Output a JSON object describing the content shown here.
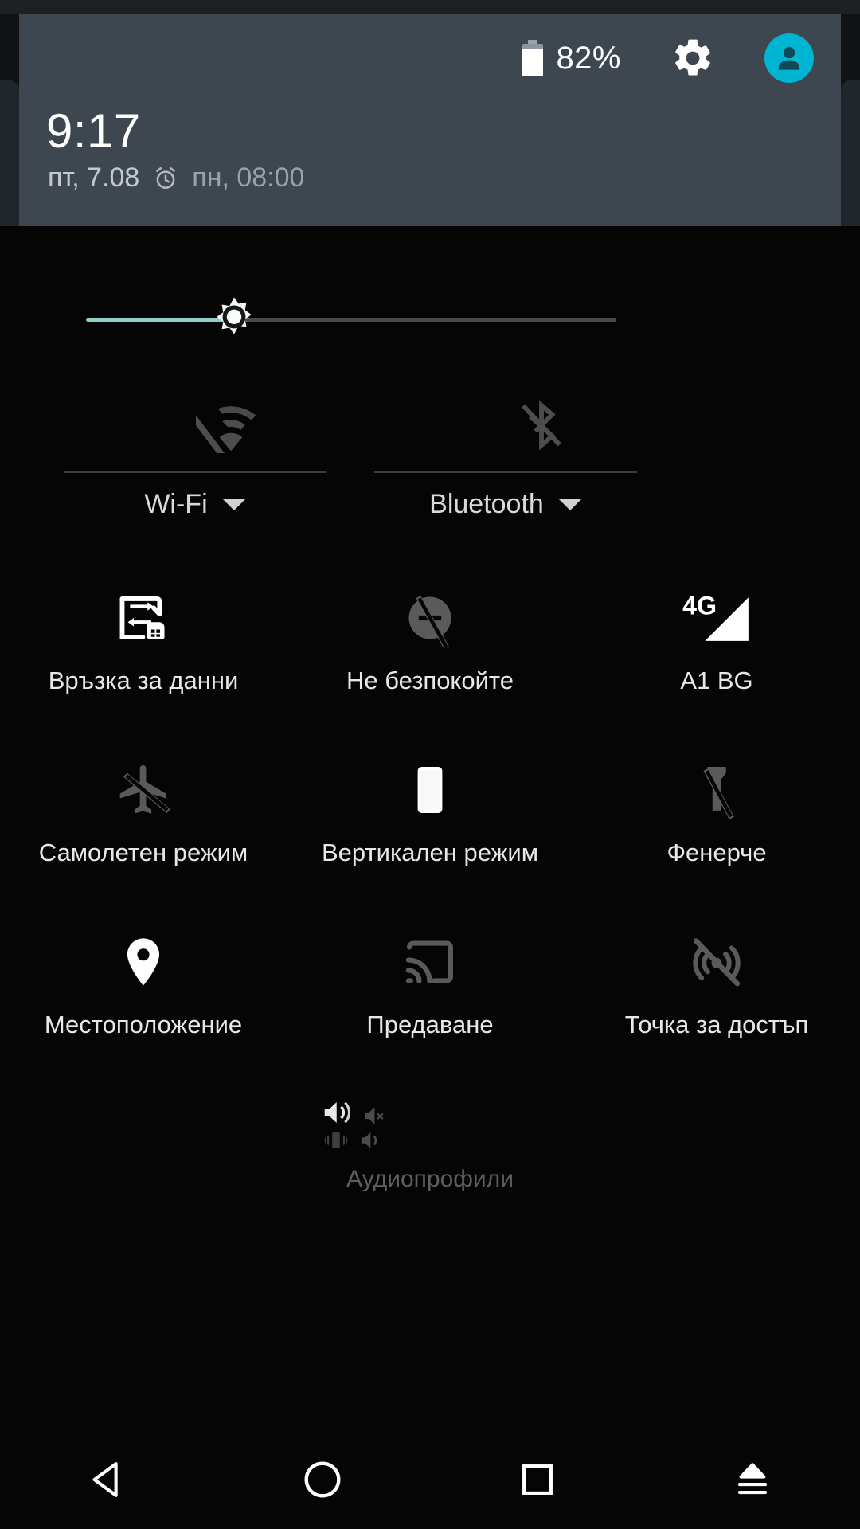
{
  "header": {
    "battery_percent": "82%",
    "battery_icon": "battery-icon",
    "settings_icon": "gear-icon",
    "avatar_icon": "user-avatar-icon",
    "avatar_color": "#00b5d1",
    "clock": "9:17",
    "date": "пт, 7.08",
    "alarm_icon": "alarm-clock-icon",
    "alarm_time": "пн, 08:00",
    "background_color": "#3e474f"
  },
  "brightness": {
    "name": "brightness-slider",
    "icon": "brightness-sun-icon",
    "value_percent": 28,
    "fill_color": "#8fcdc9",
    "track_color": "#4a4a4a"
  },
  "dual_tiles": [
    {
      "name": "wifi",
      "label": "Wi-Fi",
      "icon": "wifi-off-icon",
      "state": "off",
      "has_caret": true
    },
    {
      "name": "bluetooth",
      "label": "Bluetooth",
      "icon": "bluetooth-off-icon",
      "state": "off",
      "has_caret": true
    }
  ],
  "grid": [
    [
      {
        "name": "mobile-data",
        "label": "Връзка за данни",
        "icon": "data-transfer-sim-icon",
        "state": "on"
      },
      {
        "name": "do-not-disturb",
        "label": "Не безпокойте",
        "icon": "do-not-disturb-off-icon",
        "state": "off"
      },
      {
        "name": "carrier",
        "label": "A1 BG",
        "icon": "signal-4g-icon",
        "state": "on",
        "badge": "4G"
      }
    ],
    [
      {
        "name": "airplane-mode",
        "label": "Самолетен режим",
        "icon": "airplane-off-icon",
        "state": "off"
      },
      {
        "name": "portrait-mode",
        "label": "Вертикален режим",
        "icon": "phone-portrait-icon",
        "state": "on"
      },
      {
        "name": "flashlight",
        "label": "Фенерче",
        "icon": "flashlight-off-icon",
        "state": "off"
      }
    ],
    [
      {
        "name": "location",
        "label": "Местоположение",
        "icon": "location-pin-icon",
        "state": "on"
      },
      {
        "name": "cast",
        "label": "Предаване",
        "icon": "cast-icon",
        "state": "off"
      },
      {
        "name": "hotspot",
        "label": "Точка за достъп",
        "icon": "hotspot-off-icon",
        "state": "off"
      }
    ]
  ],
  "audio": {
    "label": "Аудиопрофили",
    "icons": [
      {
        "name": "volume-loud-icon",
        "state": "on"
      },
      {
        "name": "volume-mute-icon",
        "state": "off"
      },
      {
        "name": "vibrate-icon",
        "state": "off"
      },
      {
        "name": "volume-medium-icon",
        "state": "off"
      }
    ]
  },
  "navbar": [
    {
      "name": "back-button",
      "icon": "back-triangle-icon"
    },
    {
      "name": "home-button",
      "icon": "home-circle-icon"
    },
    {
      "name": "recents-button",
      "icon": "recents-square-icon"
    },
    {
      "name": "share-button",
      "icon": "share-up-icon"
    }
  ]
}
